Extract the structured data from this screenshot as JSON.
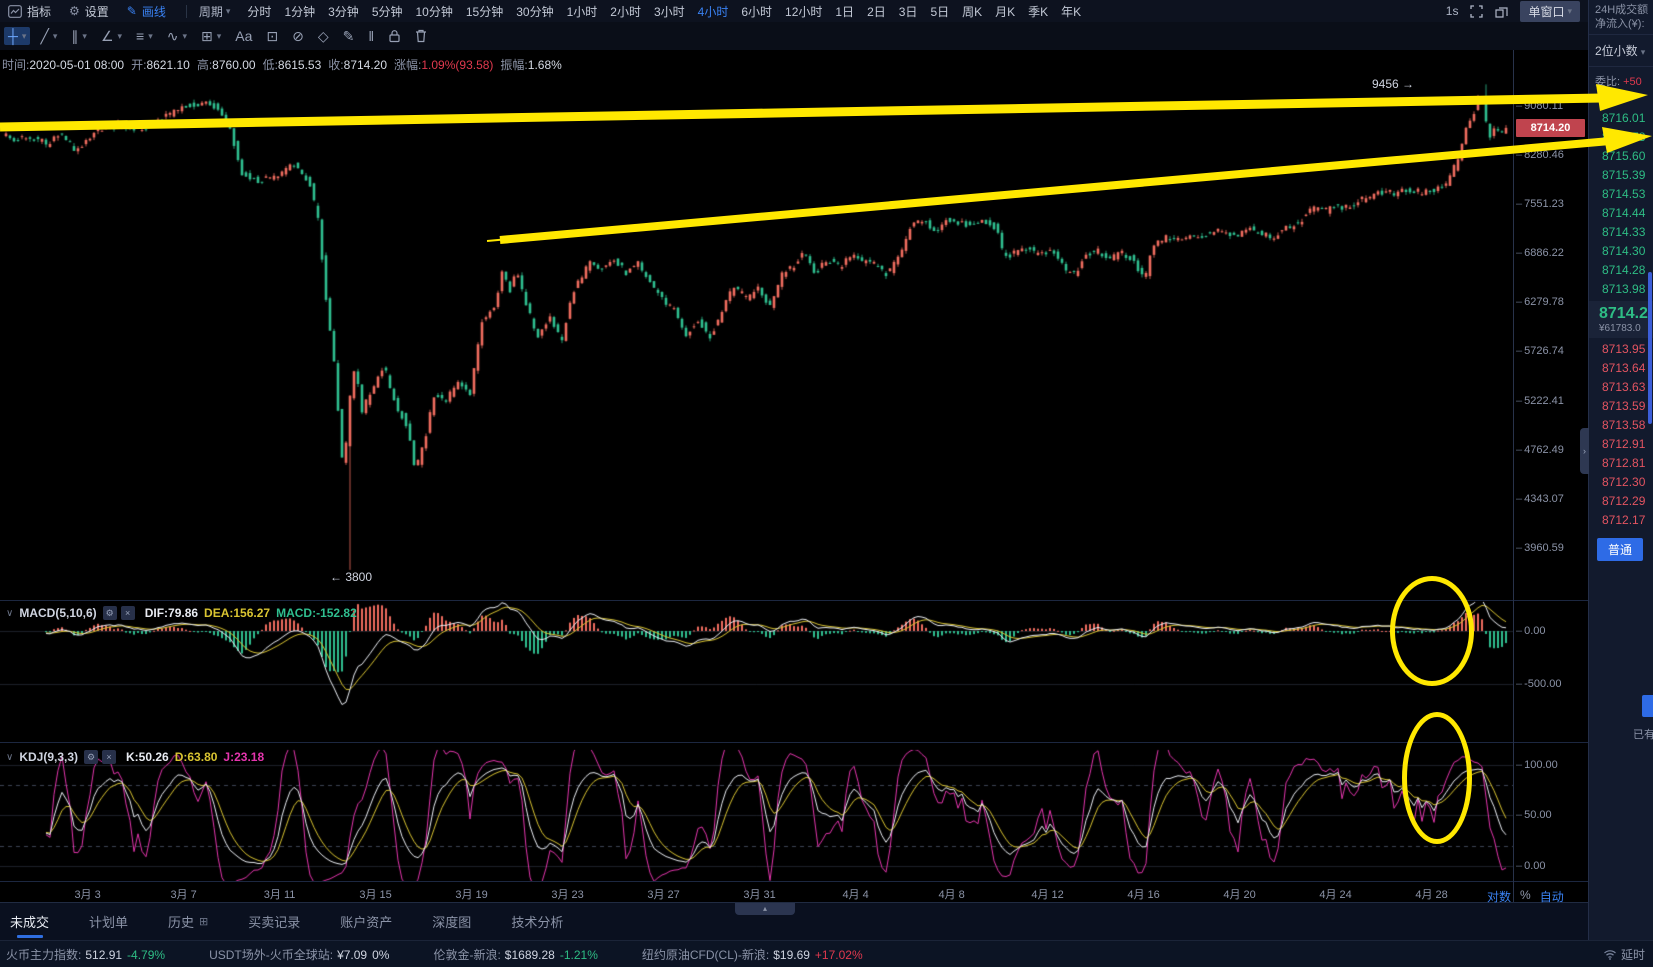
{
  "topbar": {
    "menus": [
      {
        "name": "indicator-menu",
        "icon": "indicator-icon",
        "label": "指标",
        "active": false
      },
      {
        "name": "settings-menu",
        "icon": "gear-icon",
        "label": "设置",
        "active": false
      },
      {
        "name": "draw-menu",
        "icon": "pencil-icon",
        "label": "画线",
        "active": true
      }
    ],
    "period_label": "周期",
    "periods": [
      "分时",
      "1分钟",
      "3分钟",
      "5分钟",
      "10分钟",
      "15分钟",
      "30分钟",
      "1小时",
      "2小时",
      "3小时",
      "4小时",
      "6小时",
      "12小时",
      "1日",
      "2日",
      "3日",
      "5日",
      "周K",
      "月K",
      "季K",
      "年K"
    ],
    "active_period": "4小时",
    "refresh": "1s",
    "window_mode": "单窗口"
  },
  "drawbar": {
    "tools": [
      {
        "name": "crosshair-tool",
        "glyph": "┼",
        "active": true,
        "caret": true
      },
      {
        "name": "trendline-tool",
        "glyph": "╱",
        "caret": true
      },
      {
        "name": "parallel-lines-tool",
        "glyph": "∥",
        "caret": true
      },
      {
        "name": "angle-tool",
        "glyph": "∠",
        "caret": true
      },
      {
        "name": "horizontal-line-tool",
        "glyph": "≡",
        "caret": true
      },
      {
        "name": "wave-tool",
        "glyph": "∿",
        "caret": true
      },
      {
        "name": "rectangle-tool",
        "glyph": "⊞",
        "caret": true
      },
      {
        "name": "text-tool",
        "glyph": "Aa",
        "caret": false
      },
      {
        "name": "edit-box-tool",
        "glyph": "⊡",
        "caret": false
      },
      {
        "name": "unlink-tool",
        "glyph": "⊘",
        "caret": false
      },
      {
        "name": "tag-tool",
        "glyph": "◇",
        "caret": false
      },
      {
        "name": "freehand-tool",
        "glyph": "✎",
        "caret": false
      },
      {
        "name": "measure-tool",
        "glyph": "‖",
        "caret": false
      },
      {
        "name": "lock-tool",
        "glyph": "svg-lock",
        "caret": false
      },
      {
        "name": "delete-tool",
        "glyph": "svg-trash",
        "caret": false
      }
    ]
  },
  "ohlc_info": [
    {
      "label": "时间:",
      "value": "2020-05-01 08:00",
      "cls": ""
    },
    {
      "label": "开:",
      "value": "8621.10",
      "cls": ""
    },
    {
      "label": "高:",
      "value": "8760.00",
      "cls": ""
    },
    {
      "label": "低:",
      "value": "8615.53",
      "cls": ""
    },
    {
      "label": "收:",
      "value": "8714.20",
      "cls": ""
    },
    {
      "label": "涨幅:",
      "value": "1.09%(93.58)",
      "cls": "red"
    },
    {
      "label": "振幅:",
      "value": "1.68%",
      "cls": ""
    }
  ],
  "chart_data": {
    "type": "candlestick",
    "timeframe": "4小时",
    "last_candle": {
      "time": "2020-05-01 08:00",
      "open": 8621.1,
      "high": 8760.0,
      "low": 8615.53,
      "close": 8714.2,
      "change_pct": 1.09,
      "change_abs": 93.58,
      "amplitude_pct": 1.68
    },
    "price_axis_labels": [
      "9080.11",
      "8280.46",
      "7551.23",
      "6886.22",
      "6279.78",
      "5726.74",
      "5222.41",
      "4762.49",
      "4343.07",
      "3960.59"
    ],
    "current_price_label": "8714.20",
    "high_annotation": "9456 →",
    "low_annotation": "← 3800",
    "x_axis_labels": [
      "3月 3",
      "3月 7",
      "3月 11",
      "3月 15",
      "3月 19",
      "3月 23",
      "3月 27",
      "3月 31",
      "4月 4",
      "4月 8",
      "4月 12",
      "4月 16",
      "4月 20",
      "4月 24",
      "4月 28"
    ],
    "scale_options": [
      "对数",
      "%",
      "自动"
    ],
    "colors": {
      "up": "#ef6c5f",
      "down": "#2fbe8f",
      "dif": "#eceff5",
      "dea": "#d9c431",
      "j": "#e535ae",
      "annotation": "#ffe800",
      "axis_text": "#8b93a7"
    },
    "price_path": [
      [
        -1.4,
        8610
      ],
      [
        -0.8,
        8520
      ],
      [
        0,
        8560
      ],
      [
        0.5,
        8440
      ],
      [
        1,
        8640
      ],
      [
        1.7,
        8340
      ],
      [
        2.5,
        8680
      ],
      [
        3.5,
        8760
      ],
      [
        4.5,
        8700
      ],
      [
        5.3,
        8880
      ],
      [
        6.1,
        9050
      ],
      [
        6.9,
        9140
      ],
      [
        7.6,
        9060
      ],
      [
        8.1,
        8700
      ],
      [
        8.6,
        8020
      ],
      [
        9.3,
        7890
      ],
      [
        10.0,
        7960
      ],
      [
        10.7,
        8150
      ],
      [
        11.4,
        7860
      ],
      [
        11.8,
        7280
      ],
      [
        12.1,
        6300
      ],
      [
        12.4,
        5700
      ],
      [
        12.65,
        4980
      ],
      [
        12.85,
        4450
      ],
      [
        13.0,
        5100
      ],
      [
        13.3,
        5550
      ],
      [
        13.6,
        5120
      ],
      [
        14.0,
        5330
      ],
      [
        14.5,
        5580
      ],
      [
        15.0,
        5180
      ],
      [
        15.5,
        4980
      ],
      [
        15.8,
        4560
      ],
      [
        16.2,
        4820
      ],
      [
        16.6,
        5280
      ],
      [
        17.1,
        5230
      ],
      [
        17.6,
        5390
      ],
      [
        18.1,
        5280
      ],
      [
        18.6,
        6050
      ],
      [
        19.1,
        6220
      ],
      [
        19.45,
        6640
      ],
      [
        19.75,
        6420
      ],
      [
        20.05,
        6680
      ],
      [
        20.4,
        6280
      ],
      [
        20.9,
        5880
      ],
      [
        21.4,
        6120
      ],
      [
        21.9,
        5830
      ],
      [
        22.4,
        6420
      ],
      [
        23.1,
        6760
      ],
      [
        23.6,
        6680
      ],
      [
        24.1,
        6820
      ],
      [
        24.6,
        6640
      ],
      [
        25.1,
        6760
      ],
      [
        25.6,
        6520
      ],
      [
        26.1,
        6320
      ],
      [
        26.6,
        6180
      ],
      [
        27.1,
        5920
      ],
      [
        27.6,
        6080
      ],
      [
        28.1,
        5880
      ],
      [
        28.6,
        6180
      ],
      [
        29.1,
        6470
      ],
      [
        29.6,
        6330
      ],
      [
        30.1,
        6440
      ],
      [
        30.6,
        6230
      ],
      [
        31.1,
        6620
      ],
      [
        31.6,
        6740
      ],
      [
        32.0,
        6930
      ],
      [
        32.4,
        6620
      ],
      [
        33.0,
        6790
      ],
      [
        33.5,
        6710
      ],
      [
        34.0,
        6860
      ],
      [
        34.5,
        6770
      ],
      [
        35.0,
        6730
      ],
      [
        35.5,
        6610
      ],
      [
        36.0,
        6850
      ],
      [
        36.5,
        7270
      ],
      [
        37.0,
        7330
      ],
      [
        37.5,
        7140
      ],
      [
        38.0,
        7350
      ],
      [
        38.5,
        7290
      ],
      [
        39.0,
        7270
      ],
      [
        39.5,
        7340
      ],
      [
        40.0,
        7230
      ],
      [
        40.35,
        6840
      ],
      [
        40.85,
        6890
      ],
      [
        41.35,
        6940
      ],
      [
        41.85,
        6860
      ],
      [
        42.35,
        6920
      ],
      [
        42.85,
        6690
      ],
      [
        43.25,
        6610
      ],
      [
        43.75,
        6860
      ],
      [
        44.25,
        6920
      ],
      [
        44.75,
        6820
      ],
      [
        45.25,
        6880
      ],
      [
        45.75,
        6810
      ],
      [
        46.2,
        6530
      ],
      [
        46.55,
        6990
      ],
      [
        47.05,
        7090
      ],
      [
        47.55,
        7040
      ],
      [
        48.05,
        7140
      ],
      [
        48.55,
        7070
      ],
      [
        49.05,
        7190
      ],
      [
        49.55,
        7140
      ],
      [
        50.05,
        7110
      ],
      [
        50.55,
        7220
      ],
      [
        51.05,
        7140
      ],
      [
        51.55,
        7090
      ],
      [
        52.05,
        7210
      ],
      [
        52.55,
        7270
      ],
      [
        53.2,
        7490
      ],
      [
        53.7,
        7440
      ],
      [
        54.2,
        7540
      ],
      [
        54.7,
        7490
      ],
      [
        55.2,
        7610
      ],
      [
        55.7,
        7670
      ],
      [
        56.2,
        7740
      ],
      [
        56.7,
        7690
      ],
      [
        57.2,
        7770
      ],
      [
        57.7,
        7720
      ],
      [
        58.2,
        7750
      ],
      [
        58.7,
        7790
      ],
      [
        59.0,
        7980
      ],
      [
        59.35,
        8330
      ],
      [
        59.65,
        8730
      ],
      [
        59.85,
        8890
      ],
      [
        60.05,
        9130
      ],
      [
        60.2,
        9360
      ],
      [
        60.4,
        8870
      ],
      [
        60.6,
        8560
      ],
      [
        60.8,
        8740
      ],
      [
        61.0,
        8640
      ],
      [
        61.33,
        8714
      ]
    ],
    "extremes": {
      "low_day": 12.93,
      "low_price": 3800,
      "high_day": 60.2,
      "high_price": 9456
    },
    "indicators": {
      "macd": {
        "title": "MACD(5,10,6)",
        "params": [
          5,
          10,
          6
        ],
        "dif": 79.86,
        "dea": 156.27,
        "macd": -152.82,
        "dif_text": "DIF:79.86",
        "dea_text": "DEA:156.27",
        "macd_text": "MACD:-152.82",
        "axis_labels": [
          "0.00",
          "-500.00"
        ]
      },
      "kdj": {
        "title": "KDJ(9,3,3)",
        "params": [
          9,
          3,
          3
        ],
        "k": 50.26,
        "d": 63.8,
        "j": 23.18,
        "k_text": "K:50.26",
        "d_text": "D:63.80",
        "j_text": "J:23.18",
        "axis_labels": [
          "100.00",
          "50.00",
          "0.00"
        ]
      }
    }
  },
  "right_panel": {
    "turnover_label": "24H成交额",
    "netflow_label": "净流入(¥):",
    "decimals": "2位小数",
    "weibi_label": "委比:",
    "weibi_value": "+50",
    "asks": [
      "8716.01",
      "8715.78",
      "8715.60",
      "8715.39",
      "8714.53",
      "8714.44",
      "8714.33",
      "8714.30",
      "8714.28",
      "8713.98"
    ],
    "last_price": "8714.2",
    "last_price_cny": "¥61783.0",
    "bids": [
      "8713.95",
      "8713.64",
      "8713.63",
      "8713.59",
      "8713.58",
      "8712.91",
      "8712.81",
      "8712.30",
      "8712.29",
      "8712.17"
    ],
    "mode_button": "普通",
    "partial_text": "已有"
  },
  "tabs": [
    {
      "label": "未成交",
      "active": true,
      "has_icon": false
    },
    {
      "label": "计划单",
      "active": false,
      "has_icon": false
    },
    {
      "label": "历史",
      "active": false,
      "has_icon": true
    },
    {
      "label": "买卖记录",
      "active": false,
      "has_icon": false
    },
    {
      "label": "账户资产",
      "active": false,
      "has_icon": false
    },
    {
      "label": "深度图",
      "active": false,
      "has_icon": false
    },
    {
      "label": "技术分析",
      "active": false,
      "has_icon": false
    }
  ],
  "status_bar": {
    "items": [
      {
        "label": "火币主力指数:",
        "value": "512.91",
        "change": "-4.79%",
        "trend": "down"
      },
      {
        "label": "USDT场外-火币全球站:",
        "value": "¥7.09",
        "change": "0%",
        "trend": "flat"
      },
      {
        "label": "伦敦金-新浪:",
        "value": "$1689.28",
        "change": "-1.21%",
        "trend": "down"
      },
      {
        "label": "纽约原油CFD(CL)-新浪:",
        "value": "$19.69",
        "change": "+17.02%",
        "trend": "up"
      }
    ],
    "delay_label": "延时"
  }
}
